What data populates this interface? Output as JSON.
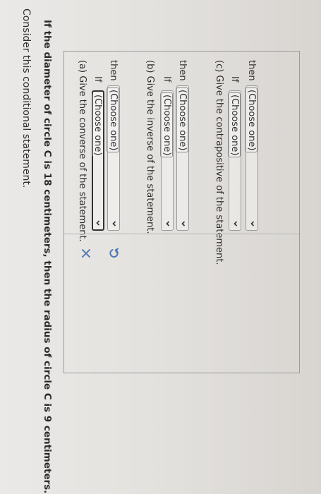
{
  "intro": "Consider this conditional statement.",
  "statement": "If the diameter of circle C is 18 centimeters, then the radius of circle C is 9 centimeters.",
  "parts": [
    {
      "heading": "(a) Give the converse of the statement.",
      "if_prefix": "If",
      "if_value": "(Choose one)",
      "then_prefix": "then",
      "then_value": "(Choose one)"
    },
    {
      "heading": "(b) Give the inverse of the statement.",
      "if_prefix": "If",
      "if_value": "(Choose one)",
      "then_prefix": "then",
      "then_value": "(Choose one)"
    },
    {
      "heading": "(c) Give the contrapositive of the statement.",
      "if_prefix": "If",
      "if_value": "(Choose one)",
      "then_prefix": "then",
      "then_value": "(Choose one)"
    }
  ],
  "actions": {
    "clear_icon": "close-icon",
    "undo_icon": "undo-icon",
    "clear_color": "#5a7fb5",
    "undo_color": "#4f76b2"
  }
}
